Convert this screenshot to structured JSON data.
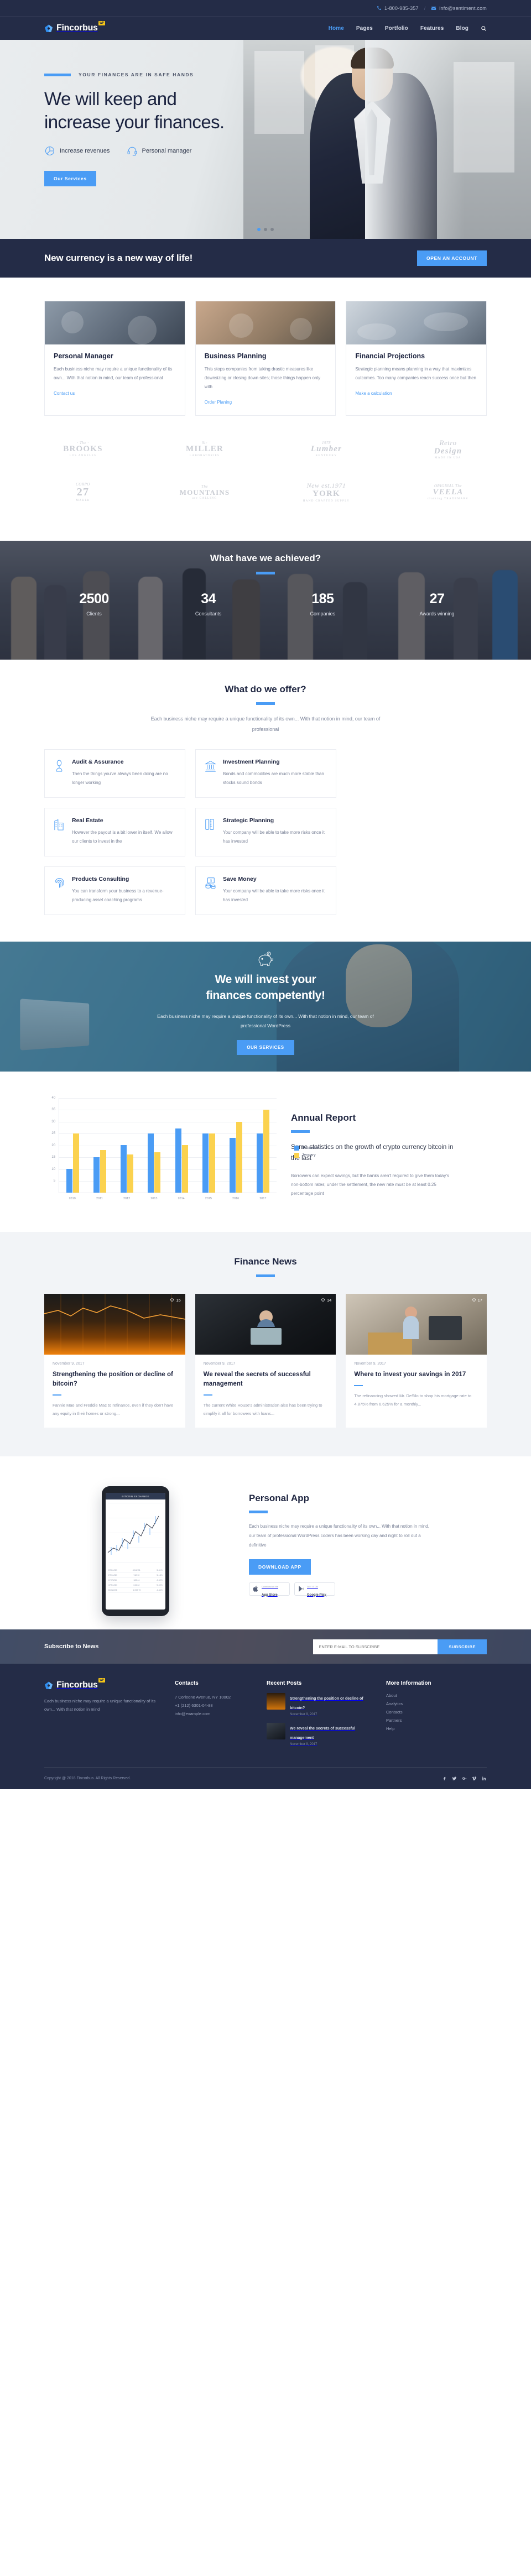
{
  "topbar": {
    "phone": "1-800-985-357",
    "separator": "/",
    "email": "info@sentiment.com",
    "phone_icon": "phone-icon",
    "email_icon": "envelope-icon"
  },
  "brand": {
    "name": "Fincorbus",
    "badge": "WP",
    "logo_icon": "pentagon-logo-icon"
  },
  "nav": {
    "items": [
      {
        "label": "Home",
        "active": true
      },
      {
        "label": "Pages",
        "active": false
      },
      {
        "label": "Portfolio",
        "active": false
      },
      {
        "label": "Features",
        "active": false
      },
      {
        "label": "Blog",
        "active": false
      }
    ],
    "search_icon": "search-icon"
  },
  "hero": {
    "kicker": "YOUR FINANCES ARE IN SAFE HANDS",
    "title_line1": "We will keep and",
    "title_line2": "increase your finances.",
    "features": [
      {
        "label": "Increase revenues",
        "icon": "pie-chart-icon"
      },
      {
        "label": "Personal manager",
        "icon": "headset-icon"
      }
    ],
    "button": "Our Services",
    "slides": 3,
    "active_slide": 1
  },
  "cta": {
    "text": "New currency is a new way of life!",
    "button": "OPEN AN ACCOUNT"
  },
  "services": {
    "cards": [
      {
        "title": "Personal Manager",
        "text": "Each business niche may require a unique functionality of its own... With that notion in mind, our team of professional",
        "link": "Contact us"
      },
      {
        "title": "Business Planning",
        "text": "This stops companies from taking drastic measures like downsizing or closing down sites; those things happen only with",
        "link": "Order Planing"
      },
      {
        "title": "Financial Projections",
        "text": "Strategic planning means planning in a way that maximizes outcomes. Too many companies reach success once but then",
        "link": "Make a calculation"
      }
    ]
  },
  "clients": {
    "row1": [
      {
        "top": "· The ·",
        "main": "BROOKS",
        "sub": "LOS ANGELES"
      },
      {
        "top": "Sir",
        "main": "MILLER",
        "sub": "LABORATORIES"
      },
      {
        "top": "1978",
        "main": "Lumber",
        "sub": "KENTUCKY"
      },
      {
        "top": "Retro",
        "main": "Design",
        "sub": "MADE IN USA"
      }
    ],
    "row2": [
      {
        "top": "CORPO",
        "main": "27",
        "sub": "MAKER"
      },
      {
        "top": "The",
        "main": "MOUNTAINS",
        "sub": "are CALLING"
      },
      {
        "top": "New est.1971",
        "main": "YORK",
        "sub": "HAND CRAFTED SUPPLY"
      },
      {
        "top": "ORIGINAL The",
        "main": "VEELA",
        "sub": "clothing TRADEMARK"
      }
    ]
  },
  "achieved": {
    "title": "What have we achieved?",
    "stats": [
      {
        "number": "2500",
        "label": "Clients"
      },
      {
        "number": "34",
        "label": "Consultants"
      },
      {
        "number": "185",
        "label": "Companies"
      },
      {
        "number": "27",
        "label": "Awards winning"
      }
    ]
  },
  "offer": {
    "title": "What do we offer?",
    "subtitle": "Each business niche may require a unique functionality of its own... With that notion in mind, our team of professional",
    "cards": [
      {
        "title": "Audit & Assurance",
        "text": "Then the things you've always been doing are no longer working",
        "icon": "person-audit-icon"
      },
      {
        "title": "Investment Planning",
        "text": "Bonds and commodities are much more stable than stocks sound bonds",
        "icon": "bank-icon"
      },
      {
        "title": "Real Estate",
        "text": "However the payout is a bit lower in itself. We allow our clients to invest in the",
        "icon": "building-icon"
      },
      {
        "title": "Strategic Planning",
        "text": "Your company will be able to take more risks once it has invested",
        "icon": "ruler-icon"
      },
      {
        "title": "Products Consulting",
        "text": "You can transform your business to a revenue-producing asset coaching programs",
        "icon": "fingerprint-icon"
      },
      {
        "title": "Save Money",
        "text": "Your company will be able to take more risks once it has invested",
        "icon": "money-stack-icon"
      }
    ]
  },
  "invest": {
    "icon": "piggy-bank-icon",
    "title_line1": "We will invest your",
    "title_line2": "finances competently!",
    "text": "Each business niche may require a unique functionality of its own... With that notion in mind, our team of professional WordPress",
    "button": "OUR SERVICES"
  },
  "report": {
    "title": "Annual Report",
    "lead": "Some statistics on the growth of crypto currency bitcoin in the last",
    "body": "Borrowers can expect savings, but the banks aren't required to give them today's non-bottom rates; under the settlement, the new rate must be at least 0.25 percentage point"
  },
  "chart_data": {
    "type": "bar",
    "title": "Annual Report",
    "categories": [
      "2010",
      "2011",
      "2012",
      "2013",
      "2014",
      "2015",
      "2016",
      "2017"
    ],
    "series": [
      {
        "name": "December",
        "values": [
          10,
          15,
          20,
          25,
          27,
          25,
          23,
          25
        ],
        "color": "#4a9cf5"
      },
      {
        "name": "Jenuary",
        "values": [
          25,
          18,
          16,
          17,
          20,
          25,
          30,
          35
        ],
        "color": "#fbd24f"
      }
    ],
    "ylim": [
      0,
      40
    ],
    "yticks": [
      0,
      5,
      10,
      15,
      20,
      25,
      30,
      35,
      40
    ],
    "xlabel": "",
    "ylabel": "",
    "grid": true,
    "legend_position": "right"
  },
  "news": {
    "title": "Finance News",
    "posts": [
      {
        "date": "November 9, 2017",
        "title": "Strengthening the position or decline of bitcoin?",
        "text": "Fannie Mae and Freddie Mac to refinance, even if they don't have any equity in their homes or strong...",
        "likes": "15"
      },
      {
        "date": "November 9, 2017",
        "title": "We reveal the secrets of successful management",
        "text": "The current White House's administration also has been trying to simplify it all for borrowers with loans...",
        "likes": "14"
      },
      {
        "date": "November 9, 2017",
        "title": "Where to invest your savings in 2017",
        "text": "The refinancing showed Mr. DeSilo to shop his mortgage rate to 4.875% from 6.625% for a monthly...",
        "likes": "17"
      }
    ]
  },
  "app": {
    "title": "Personal App",
    "text": "Each business niche may require a unique functionality of its own... With that notion in mind, our team of professional WordPress coders has been working day and night to roll out a definitive",
    "button": "DOWNLOAD APP",
    "badges": [
      {
        "small": "Download on the",
        "big": "App Store",
        "icon": "apple-icon"
      },
      {
        "small": "GET IT ON",
        "big": "Google Play",
        "icon": "play-icon"
      }
    ],
    "phone_screen": {
      "header": "BITCOIN EXCHANGE",
      "rows": [
        {
          "c1": "BTC/USD",
          "c2": "8,542.31",
          "c3": "+2.41%"
        },
        {
          "c1": "ETH/USD",
          "c2": "742.10",
          "c3": "+1.18%"
        },
        {
          "c1": "LTC/USD",
          "c2": "183.44",
          "c3": "-0.62%"
        },
        {
          "c1": "XRP/USD",
          "c2": "0.8512",
          "c3": "+3.02%"
        },
        {
          "c1": "BCH/USD",
          "c2": "1,092.70",
          "c3": "-1.44%"
        }
      ]
    }
  },
  "subscribe": {
    "title": "Subscribe to News",
    "placeholder": "ENTER E-MAIL TO SUBSCRIBE",
    "button": "SUBSCRIBE"
  },
  "footer": {
    "about": "Each business niche may require a unique functionality of its own... With that notion in mind",
    "contacts": {
      "heading": "Contacts",
      "lines": [
        "7 Corleone Avenue, NY 10002",
        "+1 (212) 6301-04-88",
        "info@example.com"
      ]
    },
    "recent": {
      "heading": "Recent Posts",
      "posts": [
        {
          "title": "Strengthening the position or decline of bitcoin?",
          "date": "November 9, 2017"
        },
        {
          "title": "We reveal the secrets of successful management",
          "date": "November 9, 2017"
        }
      ]
    },
    "more": {
      "heading": "More Information",
      "links": [
        "About",
        "Analytics",
        "Contacts",
        "Partners",
        "Help"
      ]
    },
    "copyright": "Copyright @ 2018 Fincorbus. All Rights Reserved.",
    "social": [
      "facebook-icon",
      "twitter-icon",
      "google-plus-icon",
      "vimeo-icon",
      "linkedin-icon"
    ]
  },
  "colors": {
    "accent": "#4a9cf5",
    "dark": "#242c47",
    "yellow": "#fbd24f",
    "muted": "#7b8398"
  }
}
